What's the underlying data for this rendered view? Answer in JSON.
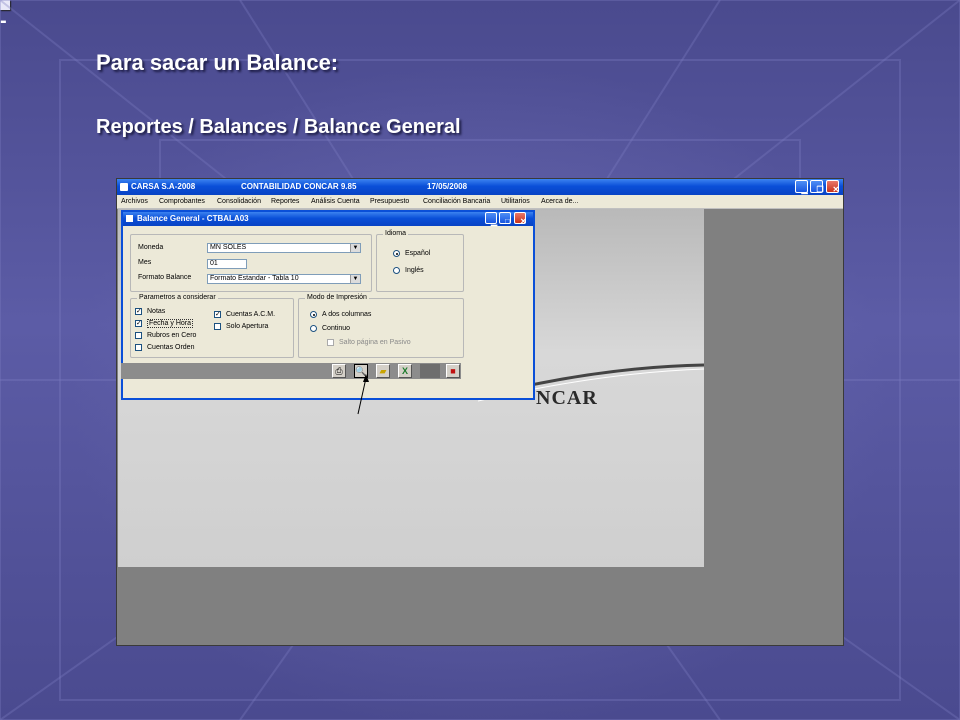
{
  "slide": {
    "heading": "Para sacar un Balance:",
    "subheading": "Reportes / Balances / Balance General",
    "sub_bullet": "-"
  },
  "app": {
    "title_company": "CARSA S.A-2008",
    "title_app": "CONTABILIDAD CONCAR 9.85",
    "title_date": "17/05/2008",
    "menu": [
      "Archivos",
      "Comprobantes",
      "Consolidación",
      "Reportes",
      "Análisis Cuenta",
      "Presupuesto",
      "Conciliación Bancaria",
      "Utilitarios",
      "Acerca de..."
    ],
    "logo_text": "NCAR"
  },
  "dialog": {
    "title": "Balance General  - CTBALA03",
    "moneda_label": "Moneda",
    "moneda_value": "MN      SOLES",
    "mes_label": "Mes",
    "mes_value": "01",
    "formato_label": "Formato Balance",
    "formato_value": "Formato Estandar - Tabla 10",
    "idioma_title": "Idioma",
    "idioma_options": [
      {
        "label": "Español",
        "selected": true
      },
      {
        "label": "Inglés",
        "selected": false
      }
    ],
    "parametros_title": "Parametros  a  considerar",
    "parametros": [
      {
        "label": "Notas",
        "checked": true
      },
      {
        "label": "Fecha y Hora",
        "checked": true
      },
      {
        "label": "Rubros en Cero",
        "checked": false
      },
      {
        "label": "Cuentas Orden",
        "checked": false
      },
      {
        "label": "Cuentas A.C.M.",
        "checked": true
      },
      {
        "label": "Solo Apertura",
        "checked": false
      }
    ],
    "modo_title": "Modo de Impresión",
    "modo_options": [
      {
        "label": "A dos columnas",
        "selected": true
      },
      {
        "label": "Continuo",
        "selected": false
      }
    ],
    "salto_label": "Salto página en Pasivo",
    "toolbar_icons": [
      "printer-icon",
      "preview-icon",
      "open-folder-icon",
      "excel-icon",
      "exit-icon"
    ]
  },
  "colors": {
    "xp_blue": "#0a4fd8",
    "dialog_bg": "#ece9d8",
    "slide_bg": "#4a4a8e"
  }
}
